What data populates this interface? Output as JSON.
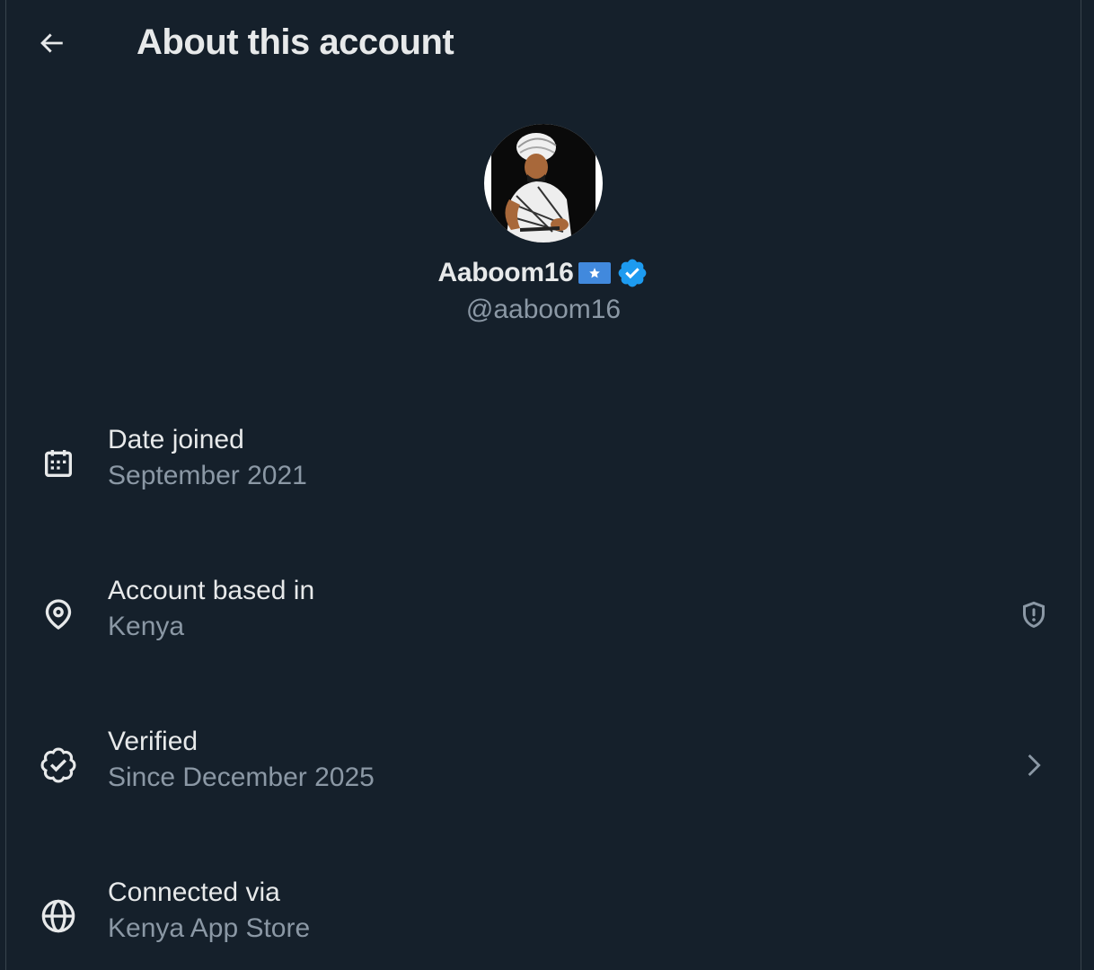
{
  "header": {
    "back_icon": "arrow-left-icon",
    "title": "About this account"
  },
  "profile": {
    "display_name": "Aaboom16",
    "flag_icon": "somalia-flag-emoji",
    "verified_icon": "verified-badge-icon",
    "username": "@aaboom16"
  },
  "details": [
    {
      "icon": "calendar-icon",
      "label": "Date joined",
      "value": "September 2021"
    },
    {
      "icon": "location-pin-icon",
      "label": "Account based in",
      "value": "Kenya",
      "trailing_icon": "shield-alert-icon"
    },
    {
      "icon": "verified-badge-outline-icon",
      "label": "Verified",
      "value": "Since December 2025",
      "trailing_icon": "chevron-right-icon"
    },
    {
      "icon": "globe-icon",
      "label": "Connected via",
      "value": "Kenya App Store"
    }
  ],
  "colors": {
    "background": "#15202b",
    "text_primary": "#e7e9ea",
    "text_secondary": "#8b98a5",
    "verified_blue": "#1d9bf0",
    "flag_blue": "#4189dd"
  }
}
